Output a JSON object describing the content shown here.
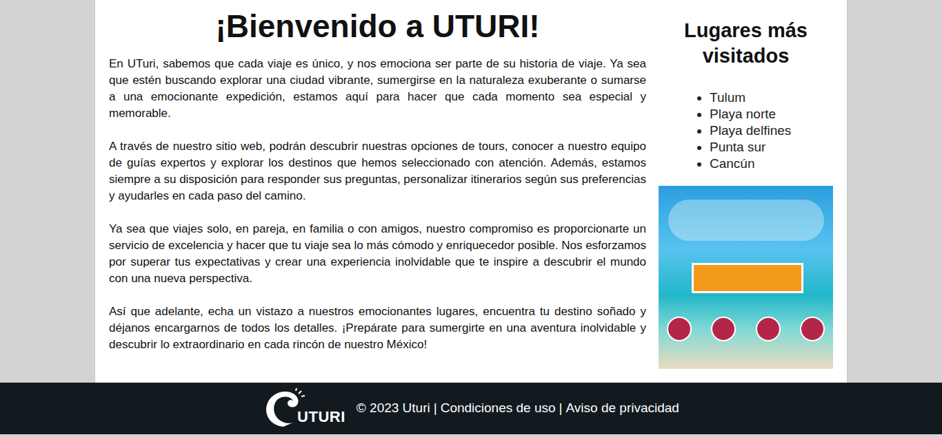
{
  "main": {
    "title": "¡Bienvenido a UTURI!",
    "paragraphs": [
      "En UTuri, sabemos que cada viaje es único, y nos emociona ser parte de su historia de viaje. Ya sea que estén buscando explorar una ciudad vibrante, sumergirse en la naturaleza exuberante o sumarse a una emocionante expedición, estamos aquí para hacer que cada momento sea especial y memorable.",
      "A través de nuestro sitio web, podrán descubrir nuestras opciones de tours, conocer a nuestro equipo de guías expertos y explorar los destinos que hemos seleccionado con atención. Además, estamos siempre a su disposición para responder sus preguntas, personalizar itinerarios según sus preferencias y ayudarles en cada paso del camino.",
      "Ya sea que viajes solo, en pareja, en familia o con amigos, nuestro compromiso es proporcionarte un servicio de excelencia y hacer que tu viaje sea lo más cómodo y enriquecedor posible. Nos esforzamos por superar tus expectativas y crear una experiencia inolvidable que te inspire a descubrir el mundo con una nueva perspectiva.",
      "Así que adelante, echa un vistazo a nuestros emocionantes lugares, encuentra tu destino soñado y déjanos encargarnos de todos los detalles. ¡Prepárate para sumergirte en una aventura inolvidable y descubrir lo extraordinario en cada rincón de nuestro México!"
    ]
  },
  "sidebar": {
    "title": "Lugares más visitados",
    "items": [
      "Tulum",
      "Playa norte",
      "Playa delfines",
      "Punta sur",
      "Cancún"
    ]
  },
  "footer": {
    "logo_text": "UTURI",
    "copyright": "© 2023 Uturi",
    "separator": "|",
    "links": [
      "Condiciones de uso",
      "Aviso de privacidad"
    ]
  }
}
